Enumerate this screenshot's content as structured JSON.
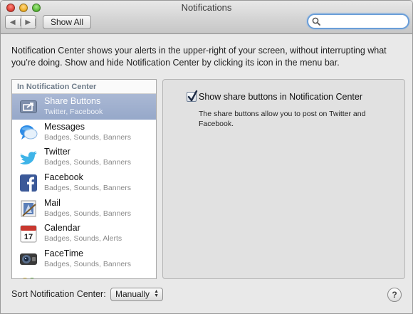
{
  "window": {
    "title": "Notifications"
  },
  "toolbar": {
    "back_icon": "left-arrow-icon",
    "forward_icon": "right-arrow-icon",
    "show_all_label": "Show All",
    "search_placeholder": ""
  },
  "intro_text": "Notification Center shows your alerts in the upper-right of your screen, without interrupting what you’re doing. Show and hide Notification Center by clicking its icon in the menu bar.",
  "app_list": {
    "header": "In Notification Center",
    "items": [
      {
        "name": "Share Buttons",
        "detail": "Twitter, Facebook",
        "icon": "share-icon",
        "selected": true
      },
      {
        "name": "Messages",
        "detail": "Badges, Sounds, Banners",
        "icon": "messages-icon",
        "selected": false
      },
      {
        "name": "Twitter",
        "detail": "Badges, Sounds, Banners",
        "icon": "twitter-icon",
        "selected": false
      },
      {
        "name": "Facebook",
        "detail": "Badges, Sounds, Banners",
        "icon": "facebook-icon",
        "selected": false
      },
      {
        "name": "Mail",
        "detail": "Badges, Sounds, Banners",
        "icon": "mail-icon",
        "selected": false
      },
      {
        "name": "Calendar",
        "detail": "Badges, Sounds, Alerts",
        "icon": "calendar-icon",
        "selected": false
      },
      {
        "name": "FaceTime",
        "detail": "Badges, Sounds, Banners",
        "icon": "facetime-icon",
        "selected": false
      },
      {
        "name": "",
        "detail": "",
        "icon": "game-center-icon",
        "selected": false
      }
    ],
    "calendar_day": "17"
  },
  "detail": {
    "checkbox_checked": true,
    "checkbox_label": "Show share buttons in Notification Center",
    "description": "The share buttons allow you to post on Twitter and Facebook."
  },
  "footer": {
    "sort_label": "Sort Notification Center:",
    "sort_value": "Manually",
    "help_label": "?"
  },
  "colors": {
    "selection": "#9fb0cf",
    "twitter": "#3fb4e8",
    "facebook": "#3b5998",
    "search_focus": "#6a9ed8"
  }
}
